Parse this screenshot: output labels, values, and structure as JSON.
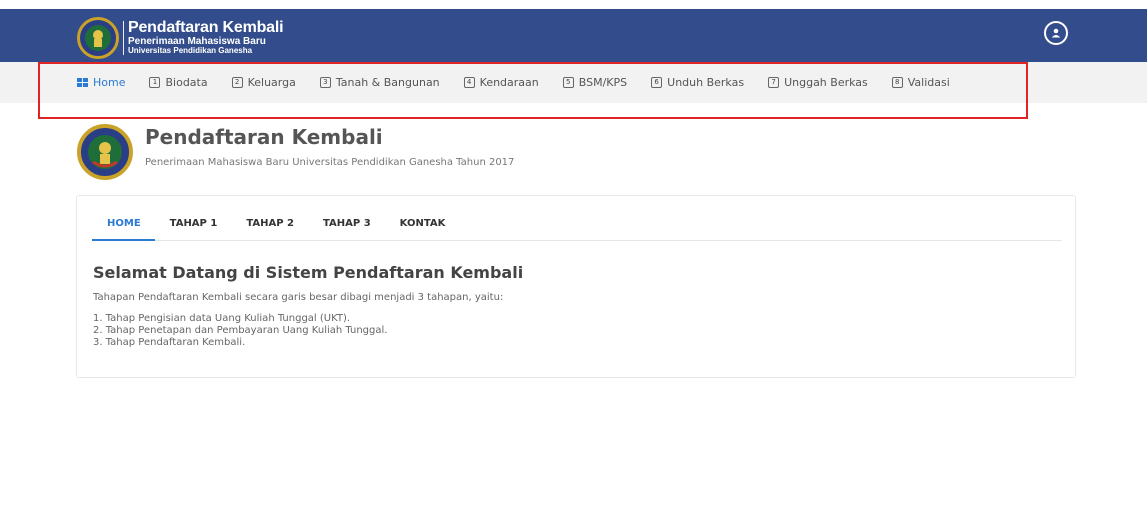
{
  "header": {
    "brand_title": "Pendaftaran Kembali",
    "brand_sub1": "Penerimaan Mahasiswa Baru",
    "brand_sub2": "Universitas Pendidikan Ganesha",
    "accent": "#334d8c"
  },
  "nav": {
    "items": [
      {
        "label": "Home",
        "icon": "home-grid-icon"
      },
      {
        "label": "Biodata",
        "num": "1"
      },
      {
        "label": "Keluarga",
        "num": "2"
      },
      {
        "label": "Tanah & Bangunan",
        "num": "3"
      },
      {
        "label": "Kendaraan",
        "num": "4"
      },
      {
        "label": "BSM/KPS",
        "num": "5"
      },
      {
        "label": "Unduh Berkas",
        "num": "6"
      },
      {
        "label": "Unggah Berkas",
        "num": "7"
      },
      {
        "label": "Validasi",
        "num": "8"
      }
    ],
    "highlight_color": "#e02424"
  },
  "page": {
    "title": "Pendaftaran Kembali",
    "subtitle": "Penerimaan Mahasiswa Baru Universitas Pendidikan Ganesha Tahun 2017"
  },
  "card": {
    "tabs": [
      "HOME",
      "TAHAP 1",
      "TAHAP 2",
      "TAHAP 3",
      "KONTAK"
    ],
    "welcome": "Selamat Datang di Sistem Pendaftaran Kembali",
    "intro": "Tahapan Pendaftaran Kembali secara garis besar dibagi menjadi 3 tahapan, yaitu:",
    "steps": [
      "1. Tahap Pengisian data Uang Kuliah Tunggal (UKT).",
      "2. Tahap Penetapan dan Pembayaran Uang Kuliah Tunggal.",
      "3. Tahap Pendaftaran Kembali."
    ]
  }
}
